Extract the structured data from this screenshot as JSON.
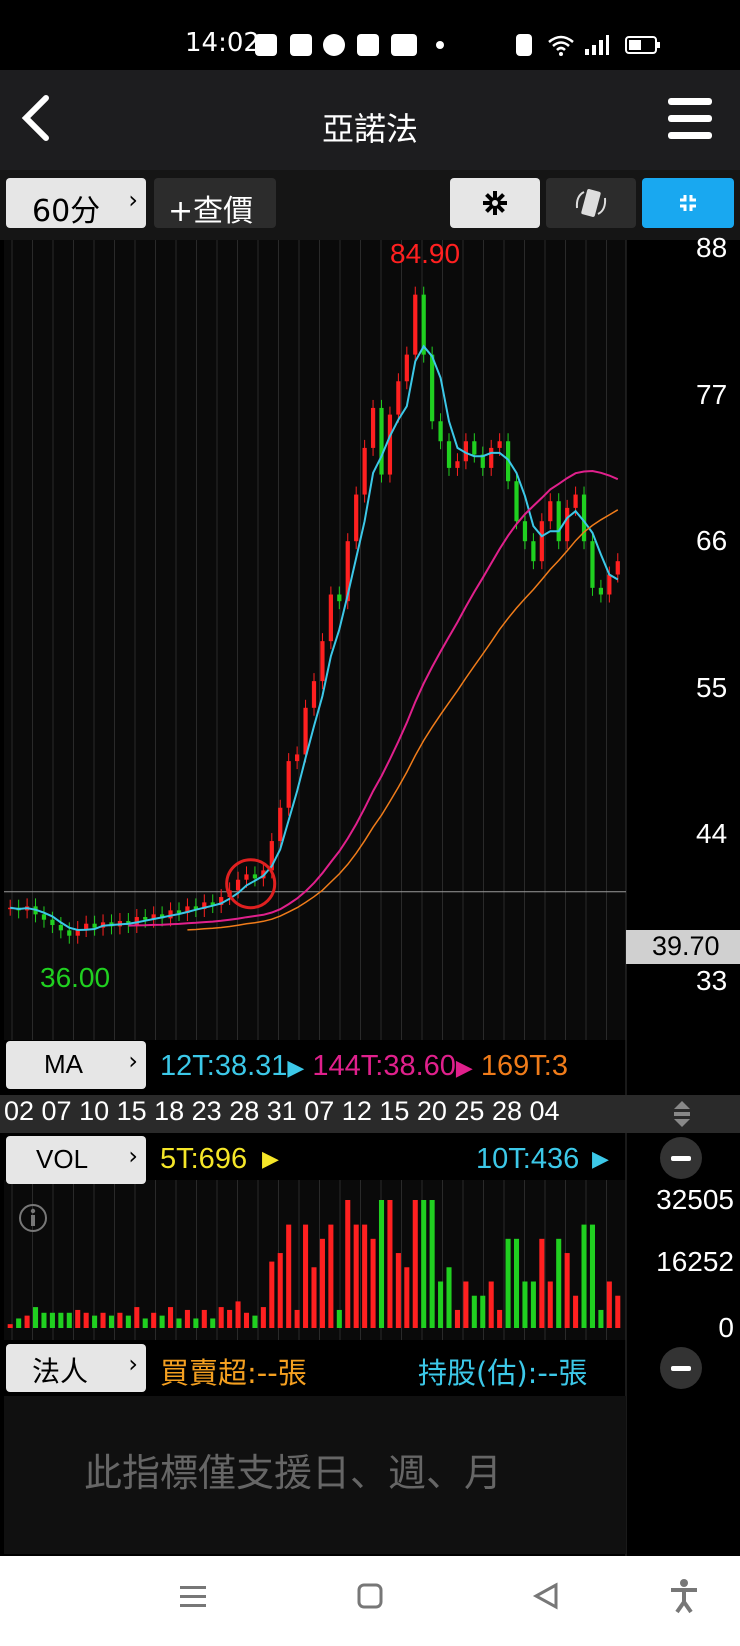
{
  "status": {
    "time": "14:02"
  },
  "header": {
    "title": "亞諾法"
  },
  "toolbar": {
    "period": "60分",
    "add_quote": "+查價"
  },
  "price": {
    "high_label": "84.90",
    "low_label": "36.00",
    "current": "39.70",
    "axis_ticks": [
      "88",
      "77",
      "66",
      "55",
      "44",
      "33"
    ]
  },
  "ma": {
    "button": "MA",
    "ma12": "12T:38.31",
    "ma144": "144T:38.60",
    "ma169": "169T:3"
  },
  "dates": [
    "02",
    "07",
    "10",
    "15",
    "18",
    "23",
    "28",
    "31",
    "07",
    "12",
    "15",
    "20",
    "25",
    "28",
    "04"
  ],
  "vol": {
    "button": "VOL",
    "ma5": "5T:696",
    "ma10": "10T:436",
    "axis_ticks": [
      "32505",
      "16252",
      "0"
    ]
  },
  "institution": {
    "button": "法人",
    "net": "買賣超:--張",
    "holding": "持股(估):--張",
    "notice": "此指標僅支援日、週、月"
  },
  "colors": {
    "up": "#ff2020",
    "down": "#20d020",
    "ma12": "#3cc8e8",
    "ma144": "#e0208c",
    "ma169": "#f07c1a",
    "accent": "#19a8f0"
  },
  "chart_data": {
    "type": "candlestick",
    "ylim": [
      33,
      88
    ],
    "closes": [
      38.5,
      38.3,
      38.6,
      38.0,
      37.6,
      37.2,
      36.8,
      36.4,
      36.9,
      37.3,
      37.0,
      37.4,
      37.1,
      37.5,
      37.2,
      37.8,
      37.6,
      38.0,
      37.7,
      38.3,
      38.1,
      38.6,
      38.4,
      38.9,
      38.7,
      39.3,
      39.8,
      40.6,
      41.0,
      40.7,
      41.3,
      43.5,
      46.0,
      49.5,
      50.0,
      53.5,
      55.5,
      58.5,
      62.0,
      61.5,
      66.0,
      69.5,
      73.0,
      76.0,
      71.0,
      75.5,
      78.0,
      80.0,
      84.5,
      80.0,
      75.0,
      73.5,
      71.5,
      72.0,
      73.5,
      72.5,
      71.5,
      73.0,
      73.5,
      70.5,
      67.5,
      66.0,
      64.5,
      67.5,
      69.0,
      66.0,
      68.5,
      69.5,
      66.0,
      62.5,
      62.0,
      63.5,
      64.5
    ]
  }
}
